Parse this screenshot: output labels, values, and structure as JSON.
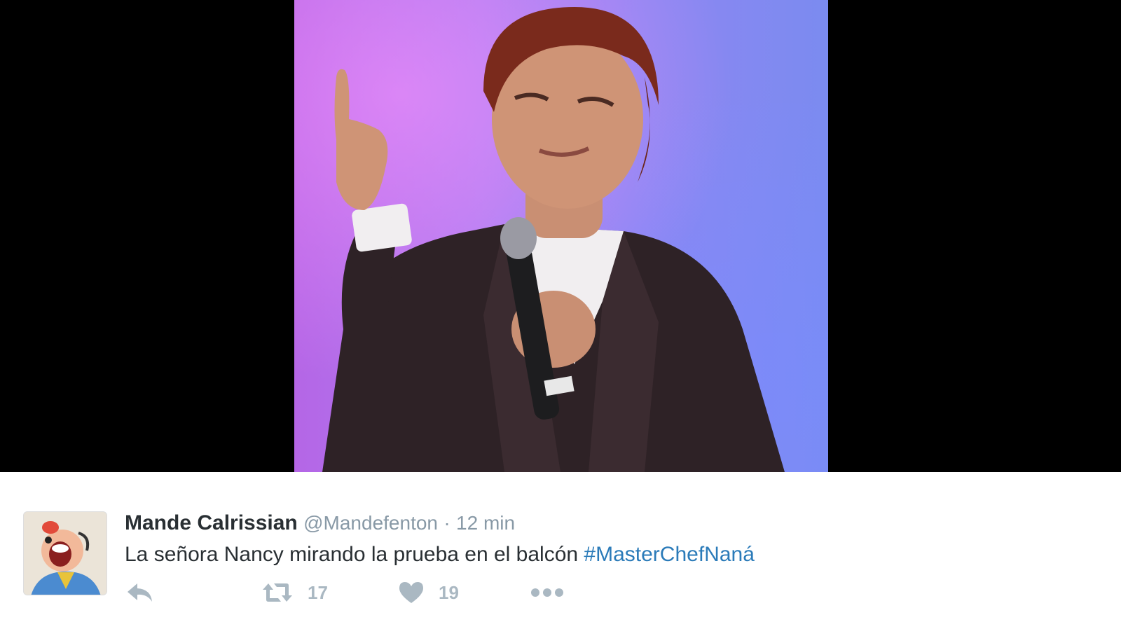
{
  "media": {
    "photo_icon": "person-singing-photo"
  },
  "tweet": {
    "avatar_icon": "cartoon-avatar-icon",
    "display_name": "Mande Calrissian",
    "handle": "@Mandefenton",
    "separator": "·",
    "timestamp": "12 min",
    "text": "La señora Nancy mirando la prueba en el balcón ",
    "hashtag": "#MasterChefNaná",
    "actions": {
      "reply_icon": "reply-icon",
      "retweet_icon": "retweet-icon",
      "retweet_count": "17",
      "like_icon": "heart-icon",
      "like_count": "19",
      "more_icon": "more-icon"
    }
  },
  "colors": {
    "name": "#292f33",
    "muted": "#8899a6",
    "hashtag": "#2b7bb9",
    "action": "#aab8c2",
    "media_background": "#000000"
  }
}
